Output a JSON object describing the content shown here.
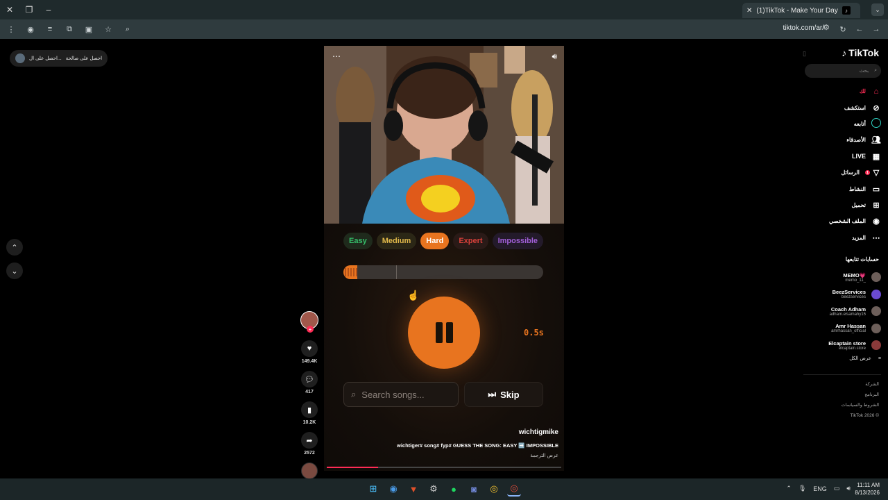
{
  "browser": {
    "tab_title": "(1)TikTok - Make Your Day",
    "url": "tiktok.com/ar/"
  },
  "banner": {
    "text1": "احصل على ال...",
    "text2": "احصل على صالحة"
  },
  "video": {
    "levels": [
      "Easy",
      "Medium",
      "Hard",
      "Expert",
      "Impossible"
    ],
    "selected_level": "Hard",
    "progress_fraction": 0.07,
    "timer": "0.5s",
    "search_placeholder": "Search songs...",
    "skip_label": "Skip",
    "username": "wichtigmike",
    "caption": "wichtiger# song# fyp# GUESS THE SONG: EASY ➡️ IMPOSSIBLE",
    "translate": "عرض الترجمة"
  },
  "actions": {
    "likes": "149.4K",
    "comments": "417",
    "saves": "10.2K",
    "shares": "2572"
  },
  "sidebar": {
    "logo": "TikTok",
    "search_placeholder": "بحث",
    "menu": [
      {
        "label": "لك",
        "icon": "home-icon"
      },
      {
        "label": "استكشف",
        "icon": "compass-icon"
      },
      {
        "label": "أتابعه",
        "icon": "following-icon"
      },
      {
        "label": "الأصدقاء",
        "icon": "friends-icon"
      },
      {
        "label": "LIVE",
        "icon": "live-icon"
      },
      {
        "label": "الرسائل",
        "icon": "messages-icon",
        "badge": "1"
      },
      {
        "label": "النشاط",
        "icon": "activity-icon"
      },
      {
        "label": "تحميل",
        "icon": "upload-icon"
      },
      {
        "label": "الملف الشخصي",
        "icon": "profile-icon"
      },
      {
        "label": "المزيد",
        "icon": "more-icon"
      }
    ],
    "following_title": "حسابات تتابعها",
    "following": [
      {
        "name": "MEMO💗",
        "handle": "memo_11_"
      },
      {
        "name": "BeezServices",
        "handle": "beezservices"
      },
      {
        "name": "Coach Adham",
        "handle": "adham.elsamahy15"
      },
      {
        "name": "Amr Hassan",
        "handle": "amrhassan_official"
      },
      {
        "name": "Elcaptain store",
        "handle": "elcaptain.store"
      }
    ],
    "see_all": "عرض الكل",
    "footer": [
      "الشركة",
      "البرنامج",
      "الشروط والسياسات",
      "TikTok 2026 ©"
    ]
  },
  "taskbar": {
    "lang": "ENG",
    "time": "11:11 AM",
    "date": "8/13/2026"
  },
  "colors": {
    "accent": "#e8741f",
    "tiktok_red": "#fe2c55"
  }
}
